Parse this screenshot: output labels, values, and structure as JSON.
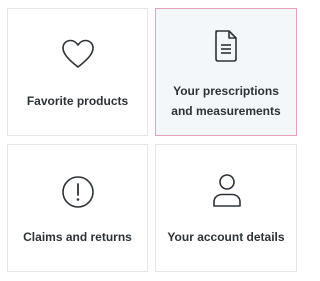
{
  "cards": [
    {
      "label": "Favorite products",
      "icon": "heart-icon",
      "selected": false
    },
    {
      "label": "Your prescriptions and measurements",
      "icon": "document-icon",
      "selected": true
    },
    {
      "label": "Claims and returns",
      "icon": "exclamation-circle-icon",
      "selected": false
    },
    {
      "label": "Your account details",
      "icon": "user-icon",
      "selected": false
    }
  ],
  "colors": {
    "text": "#2c3338",
    "border": "#e3e5e8",
    "selected_border": "#e7a1b6",
    "selected_background": "#f3f7f9"
  }
}
